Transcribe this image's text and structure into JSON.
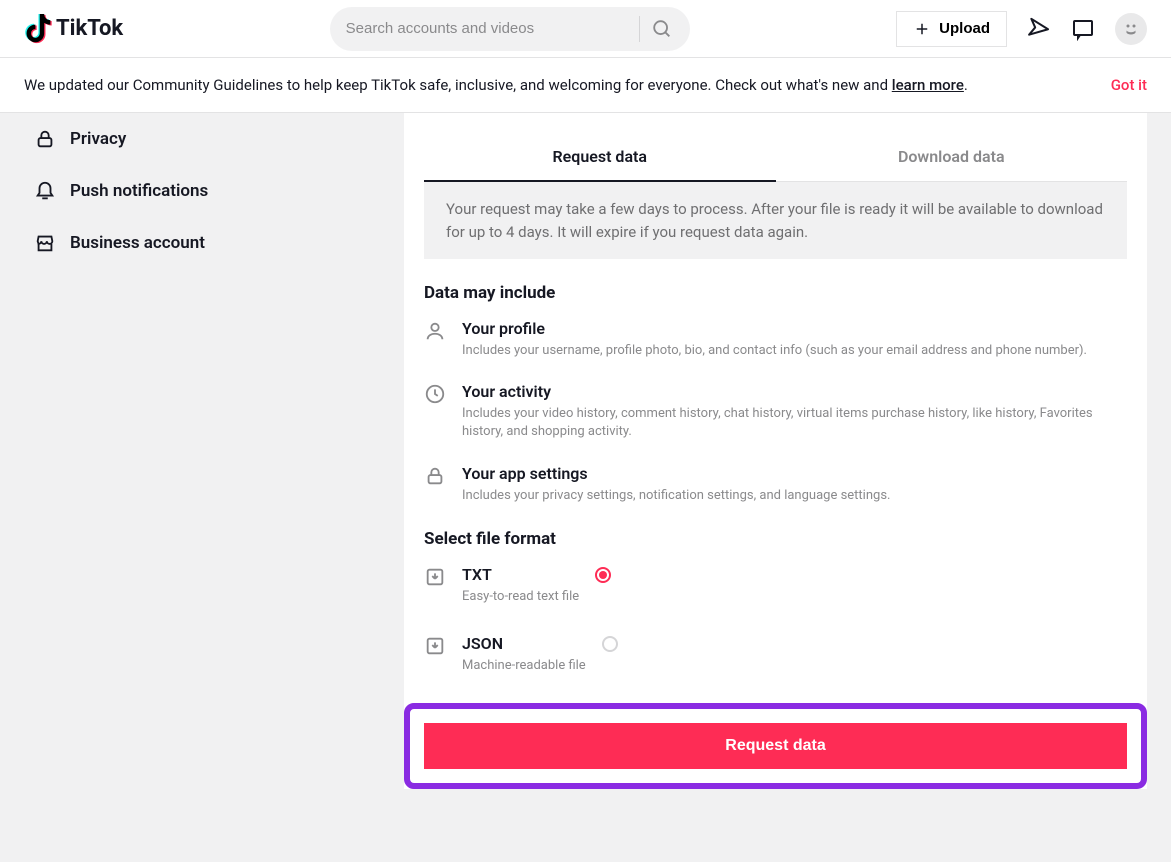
{
  "header": {
    "brand": "TikTok",
    "search_placeholder": "Search accounts and videos",
    "upload_label": "Upload"
  },
  "banner": {
    "text_before": "We updated our Community Guidelines to help keep TikTok safe, inclusive, and welcoming for everyone. Check out what's new and ",
    "link_text": "learn more",
    "text_after": ".",
    "dismiss": "Got it"
  },
  "sidebar": {
    "items": [
      {
        "label": "Privacy"
      },
      {
        "label": "Push notifications"
      },
      {
        "label": "Business account"
      }
    ]
  },
  "tabs": {
    "request": "Request data",
    "download": "Download data"
  },
  "notice": "Your request may take a few days to process. After your file is ready it will be available to download for up to 4 days. It will expire if you request data again.",
  "sections": {
    "data_include": "Data may include",
    "file_format": "Select file format"
  },
  "includes": {
    "profile": {
      "title": "Your profile",
      "desc": "Includes your username, profile photo, bio, and contact info (such as your email address and phone number)."
    },
    "activity": {
      "title": "Your activity",
      "desc": "Includes your video history, comment history, chat history, virtual items purchase history, like history, Favorites history, and shopping activity."
    },
    "settings": {
      "title": "Your app settings",
      "desc": "Includes your privacy settings, notification settings, and language settings."
    }
  },
  "formats": {
    "txt": {
      "title": "TXT",
      "desc": "Easy-to-read text file",
      "selected": true
    },
    "json": {
      "title": "JSON",
      "desc": "Machine-readable file",
      "selected": false
    }
  },
  "actions": {
    "request_button": "Request data"
  }
}
